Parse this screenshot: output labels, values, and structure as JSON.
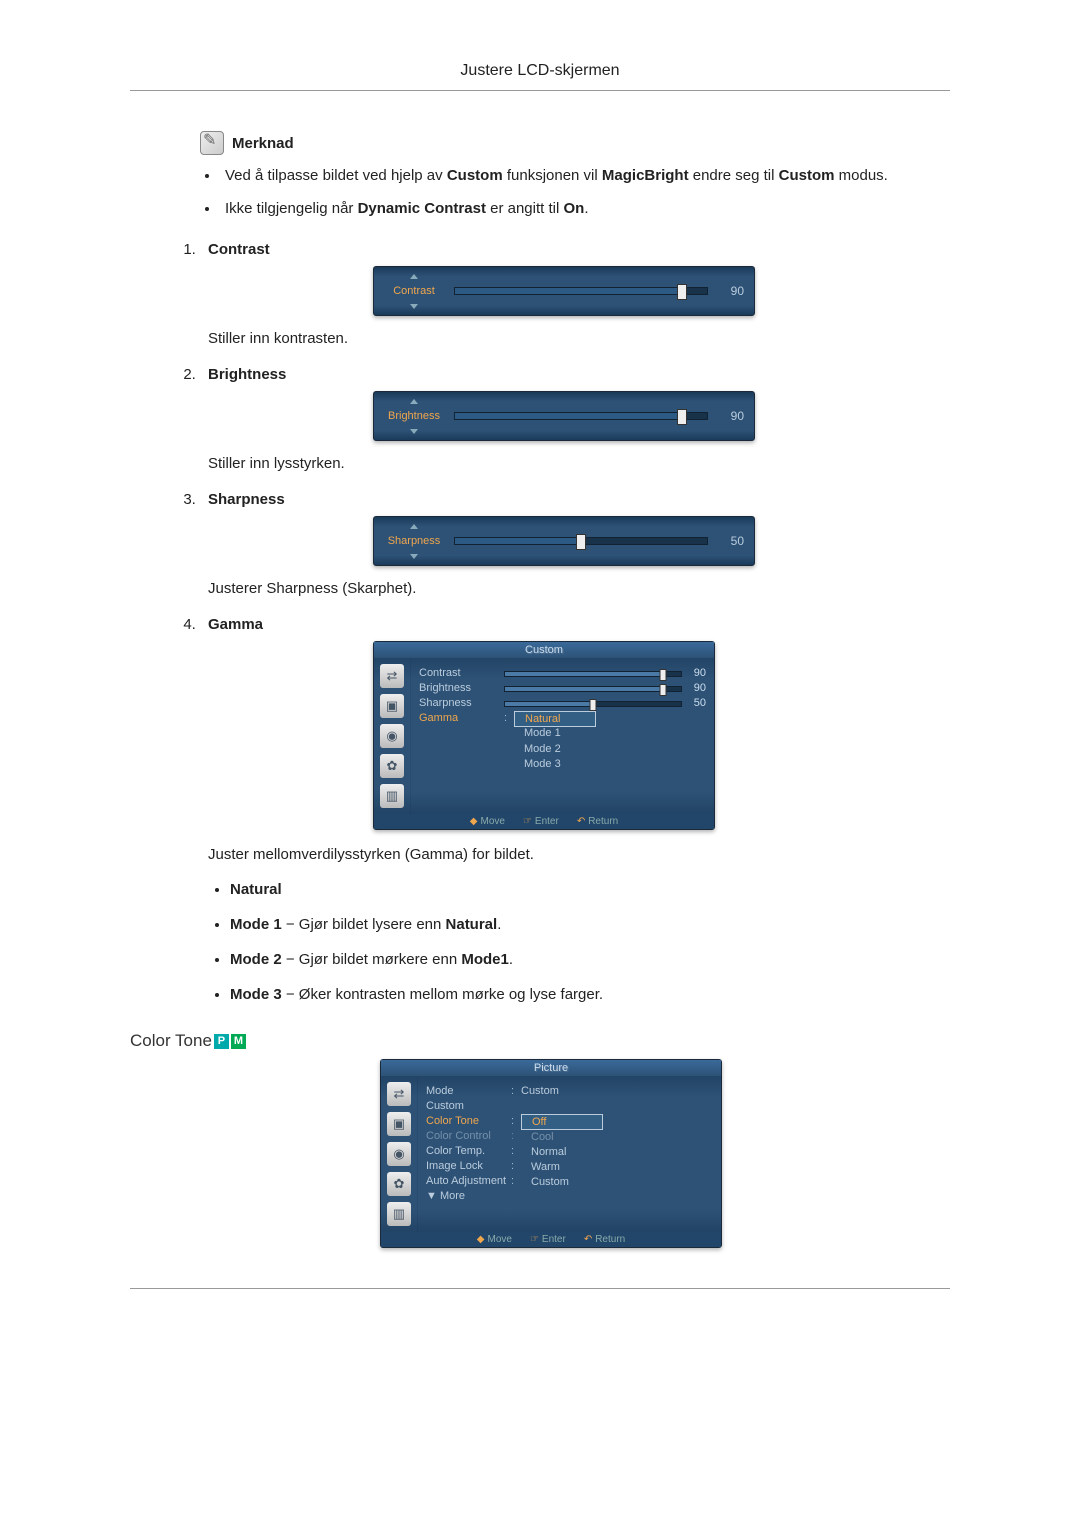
{
  "header": {
    "title": "Justere LCD-skjermen"
  },
  "note": {
    "title": "Merknad",
    "bullets": [
      {
        "pre": "Ved å tilpasse bildet ved hjelp av ",
        "b1": "Custom",
        "mid": " funksjonen vil ",
        "b2": "MagicBright",
        "post": " endre seg til ",
        "b3": "Custom",
        "tail": " modus."
      },
      {
        "pre": "Ikke tilgjengelig når ",
        "b1": "Dynamic Contrast",
        "mid": " er angitt til ",
        "b2": "On",
        "post": ".",
        "b3": "",
        "tail": ""
      }
    ]
  },
  "items": [
    {
      "label": "Contrast",
      "slider": {
        "name": "Contrast",
        "value": 90,
        "max": 100
      },
      "desc": "Stiller inn kontrasten."
    },
    {
      "label": "Brightness",
      "slider": {
        "name": "Brightness",
        "value": 90,
        "max": 100
      },
      "desc": "Stiller inn lysstyrken."
    },
    {
      "label": "Sharpness",
      "slider": {
        "name": "Sharpness",
        "value": 50,
        "max": 100
      },
      "desc": "Justerer Sharpness (Skarphet)."
    },
    {
      "label": "Gamma",
      "desc": "Juster mellomverdilysstyrken (Gamma) for bildet."
    }
  ],
  "gamma_panel": {
    "title": "Custom",
    "rows": [
      {
        "label": "Contrast",
        "value": 90
      },
      {
        "label": "Brightness",
        "value": 90
      },
      {
        "label": "Sharpness",
        "value": 50
      }
    ],
    "select_label": "Gamma",
    "options": [
      "Natural",
      "Mode 1",
      "Mode 2",
      "Mode 3"
    ],
    "selected": "Natural",
    "nav": [
      "Move",
      "Enter",
      "Return"
    ]
  },
  "gamma_sub": [
    {
      "b": "Natural",
      "t": ""
    },
    {
      "b": "Mode 1",
      "t": " − Gjør bildet lysere enn ",
      "b2": "Natural",
      "t2": "."
    },
    {
      "b": "Mode 2",
      "t": " − Gjør bildet mørkere enn ",
      "b2": "Mode1",
      "t2": "."
    },
    {
      "b": "Mode 3",
      "t": " − Øker kontrasten mellom mørke og lyse farger.",
      "b2": "",
      "t2": ""
    }
  ],
  "colortone": {
    "title": "Color Tone",
    "panel_title": "Picture",
    "rows": [
      {
        "label": "Mode",
        "val": "Custom",
        "colon": ":"
      },
      {
        "label": "Custom",
        "val": "",
        "colon": ""
      },
      {
        "label": "Color Tone",
        "val": "",
        "colon": ":"
      },
      {
        "label": "Color Control",
        "val": "",
        "colon": ":"
      },
      {
        "label": "Color Temp.",
        "val": "",
        "colon": ":"
      },
      {
        "label": "Image Lock",
        "val": "",
        "colon": ":"
      },
      {
        "label": "Auto Adjustment",
        "val": "",
        "colon": ":"
      },
      {
        "label": "▼ More",
        "val": "",
        "colon": ""
      }
    ],
    "options": [
      "Off",
      "Cool",
      "Normal",
      "Warm",
      "Custom"
    ],
    "selected": "Off",
    "nav": [
      "Move",
      "Enter",
      "Return"
    ]
  }
}
